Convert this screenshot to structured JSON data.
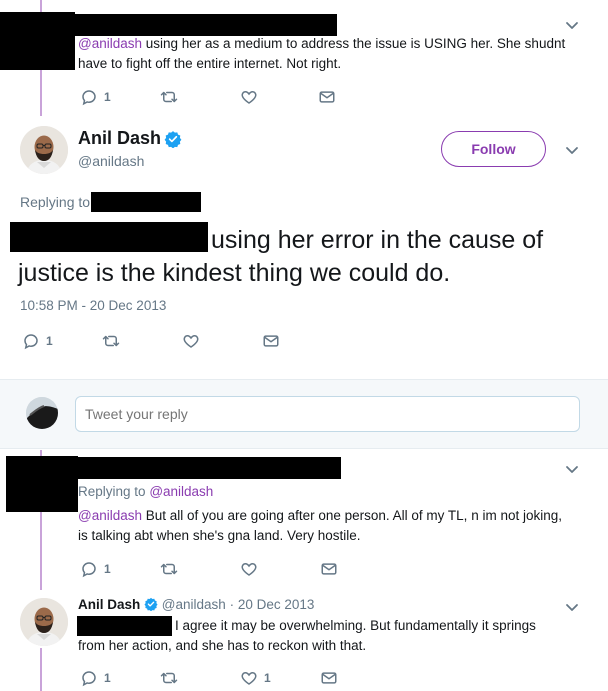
{
  "tweet1": {
    "text_mention": "@anildash",
    "text_line1_rest": " using her as a medium to address the issue is USING her. She shudnt",
    "text_line2": "have to fight off the entire internet. Not right.",
    "reply_count": "1"
  },
  "main_tweet": {
    "author_name": "Anil Dash",
    "handle": "@anildash",
    "follow_label": "Follow",
    "replying_to_label": "Replying to",
    "text_line1": "using her error in the cause of",
    "text_line2": "justice is the kindest thing we could do.",
    "timestamp": "10:58 PM - 20 Dec 2013",
    "reply_count": "1"
  },
  "reply_box": {
    "placeholder": "Tweet your reply"
  },
  "tweet3": {
    "replying_to_label": "Replying to",
    "replying_to_handle": "@anildash",
    "text_mention": "@anildash",
    "text_line1_rest": " But all of you are going after one person. All of my TL, n im not joking,",
    "text_line2": "is talking abt when she's gna land. Very hostile.",
    "reply_count": "1"
  },
  "tweet4": {
    "author_name": "Anil Dash",
    "handle": "@anildash",
    "separator": "·",
    "date": "20 Dec 2013",
    "text_line1_rest": "I agree it may be overwhelming. But fundamentally it springs",
    "text_line2": "from her action, and she has to reckon with that.",
    "reply_count": "1",
    "like_count": "1"
  },
  "colors": {
    "accent": "#8a3cb0",
    "verified": "#1da1f2",
    "muted": "#657786",
    "thread_line": "#c9a3d9"
  }
}
